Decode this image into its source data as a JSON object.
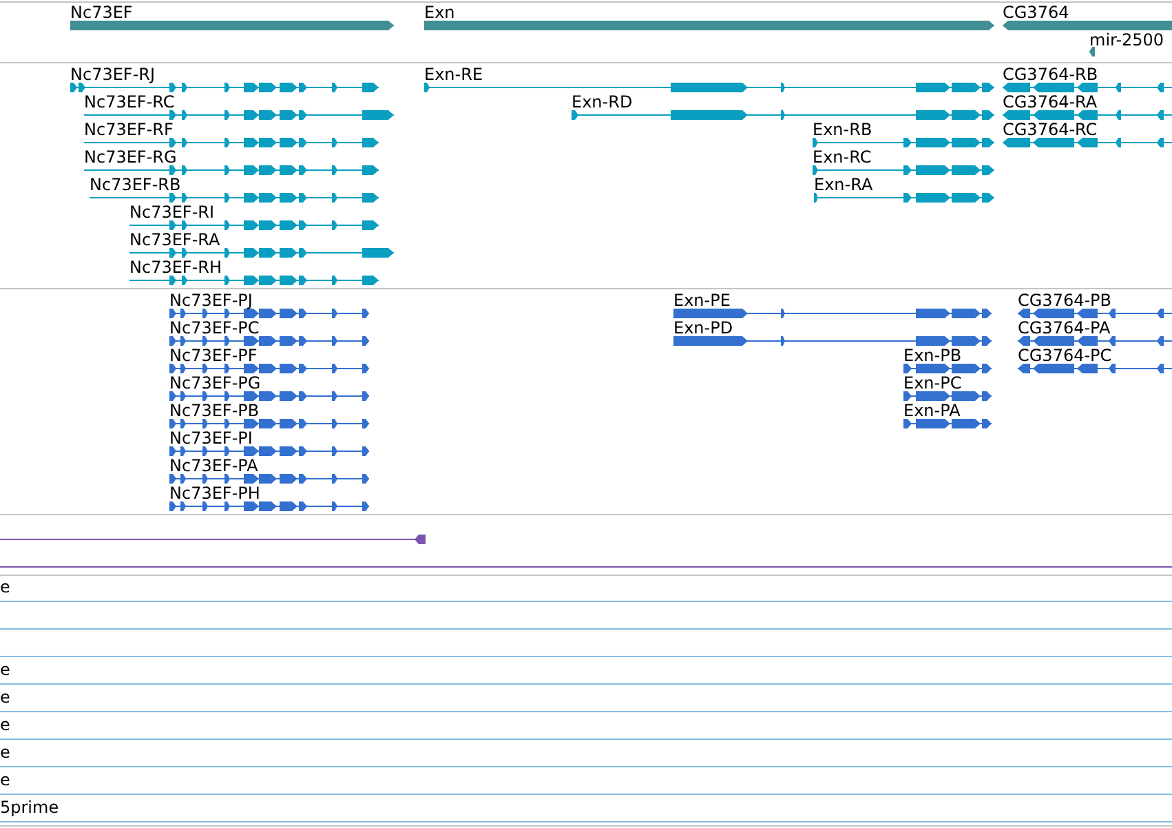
{
  "gene_track": {
    "features": [
      {
        "label": "Nc73EF",
        "kind": "forward"
      },
      {
        "label": "Exn",
        "kind": "forward"
      },
      {
        "label": "CG3764",
        "kind": "reverse"
      },
      {
        "label": "mir-2500",
        "kind": "reverse"
      }
    ]
  },
  "transcript_track": {
    "features": [
      {
        "label": "Nc73EF-RJ",
        "kind": "forward"
      },
      {
        "label": "Nc73EF-RC",
        "kind": "forward"
      },
      {
        "label": "Nc73EF-RF",
        "kind": "forward"
      },
      {
        "label": "Nc73EF-RG",
        "kind": "forward"
      },
      {
        "label": "Nc73EF-RB",
        "kind": "forward"
      },
      {
        "label": "Nc73EF-RI",
        "kind": "forward"
      },
      {
        "label": "Nc73EF-RA",
        "kind": "forward"
      },
      {
        "label": "Nc73EF-RH",
        "kind": "forward"
      },
      {
        "label": "Exn-RE",
        "kind": "forward"
      },
      {
        "label": "Exn-RD",
        "kind": "forward"
      },
      {
        "label": "Exn-RB",
        "kind": "forward"
      },
      {
        "label": "Exn-RC",
        "kind": "forward"
      },
      {
        "label": "Exn-RA",
        "kind": "forward"
      },
      {
        "label": "CG3764-RB",
        "kind": "reverse"
      },
      {
        "label": "CG3764-RA",
        "kind": "reverse"
      },
      {
        "label": "CG3764-RC",
        "kind": "reverse"
      }
    ]
  },
  "protein_track": {
    "features": [
      {
        "label": "Nc73EF-PJ",
        "kind": "forward"
      },
      {
        "label": "Nc73EF-PC",
        "kind": "forward"
      },
      {
        "label": "Nc73EF-PF",
        "kind": "forward"
      },
      {
        "label": "Nc73EF-PG",
        "kind": "forward"
      },
      {
        "label": "Nc73EF-PB",
        "kind": "forward"
      },
      {
        "label": "Nc73EF-PI",
        "kind": "forward"
      },
      {
        "label": "Nc73EF-PA",
        "kind": "forward"
      },
      {
        "label": "Nc73EF-PH",
        "kind": "forward"
      },
      {
        "label": "Exn-PE",
        "kind": "forward"
      },
      {
        "label": "Exn-PD",
        "kind": "forward"
      },
      {
        "label": "Exn-PB",
        "kind": "forward"
      },
      {
        "label": "Exn-PC",
        "kind": "forward"
      },
      {
        "label": "Exn-PA",
        "kind": "forward"
      },
      {
        "label": "CG3764-PB",
        "kind": "reverse"
      },
      {
        "label": "CG3764-PA",
        "kind": "reverse"
      },
      {
        "label": "CG3764-PC",
        "kind": "reverse"
      }
    ]
  },
  "lower_rows": [
    {
      "kind": "text",
      "label": "e"
    },
    {
      "kind": "blank"
    },
    {
      "kind": "blank"
    },
    {
      "kind": "text",
      "label": "e"
    },
    {
      "kind": "text",
      "label": "e"
    },
    {
      "kind": "text",
      "label": "e"
    },
    {
      "kind": "text",
      "label": "e"
    },
    {
      "kind": "text",
      "label": "e"
    },
    {
      "kind": "text",
      "label": "5prime"
    }
  ]
}
